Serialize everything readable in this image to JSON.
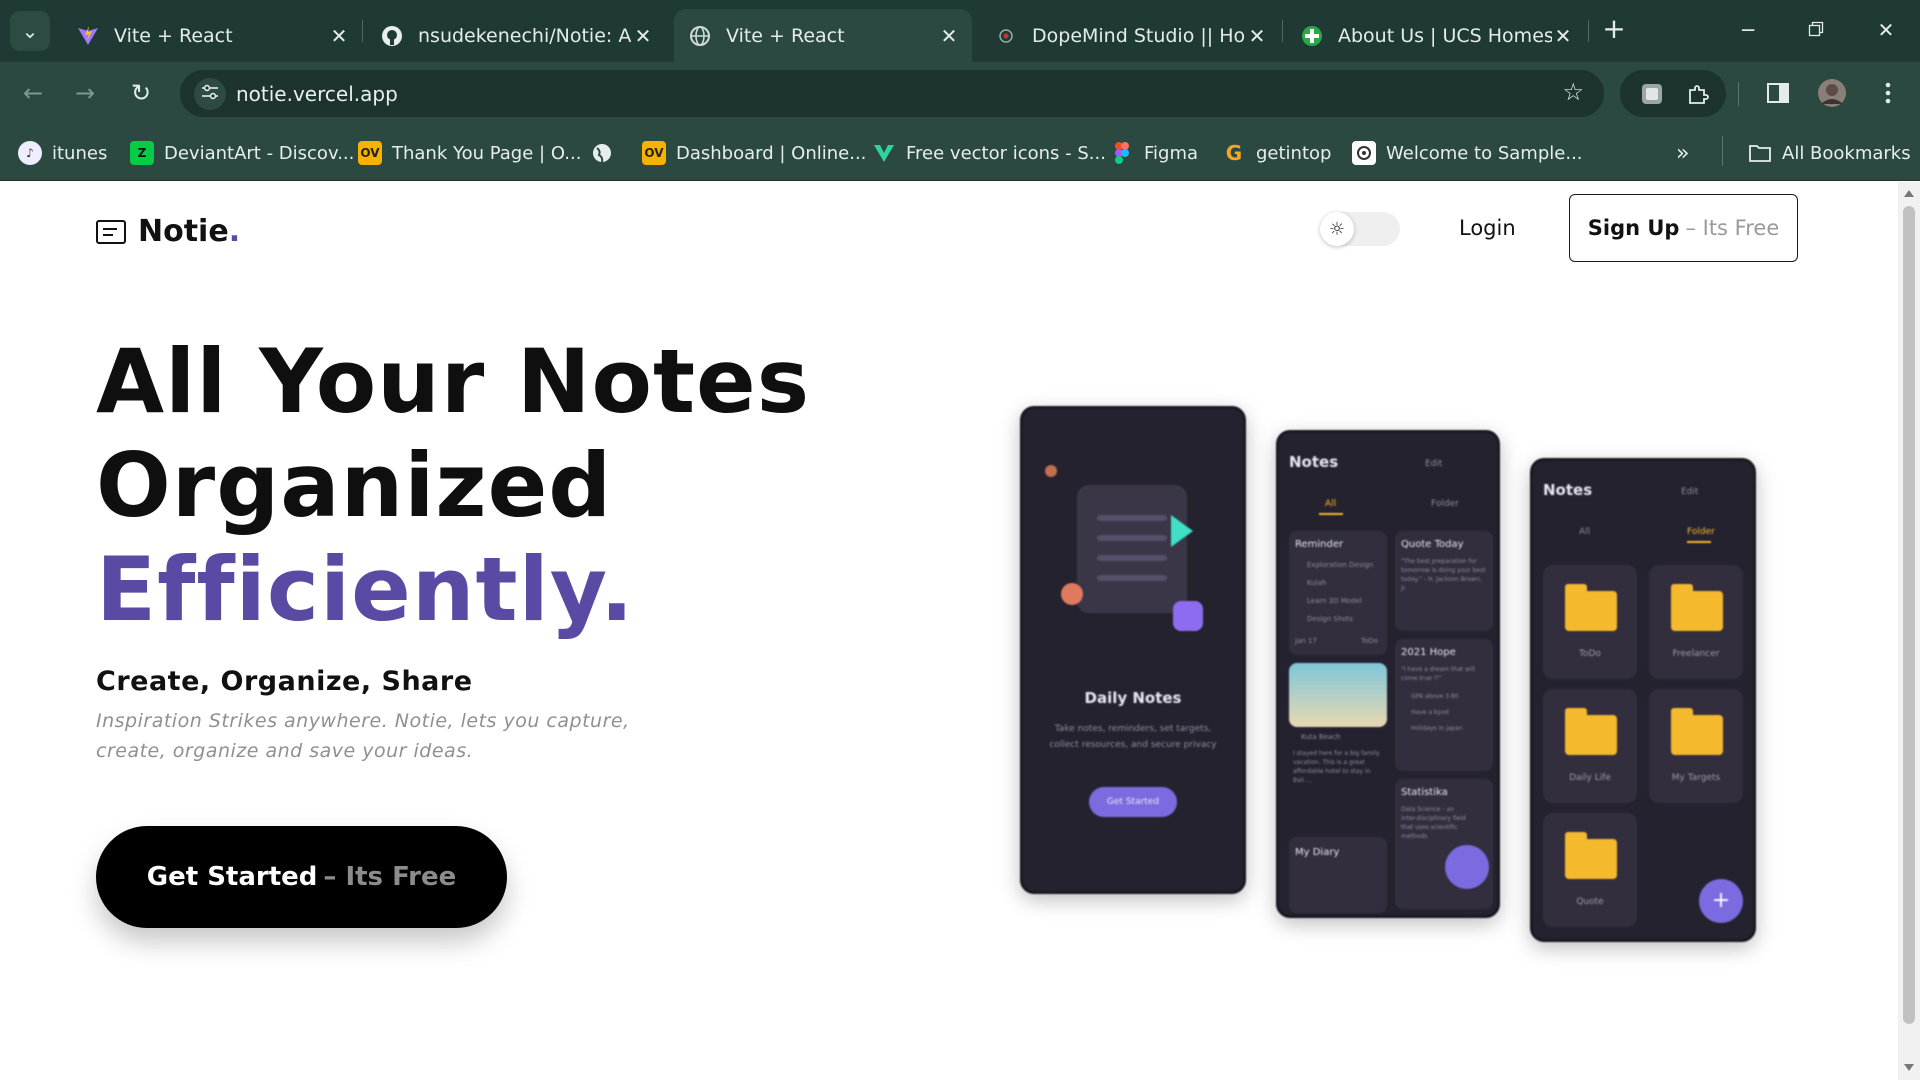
{
  "browser": {
    "tabs": [
      {
        "title": "Vite + React",
        "icon": "vite-icon",
        "active": false
      },
      {
        "title": "nsudekenechi/Notie: An",
        "icon": "github-icon",
        "active": false
      },
      {
        "title": "Vite + React",
        "icon": "globe-icon",
        "active": true
      },
      {
        "title": "DopeMind Studio || Hom",
        "icon": "dopemind-icon",
        "active": false
      },
      {
        "title": "About Us | UCS Homes",
        "icon": "ucs-homes-icon",
        "active": false
      }
    ],
    "url": "notie.vercel.app",
    "bookmarks": [
      {
        "label": "itunes",
        "icon": "itunes-icon"
      },
      {
        "label": "DeviantArt - Discov...",
        "icon": "deviantart-icon"
      },
      {
        "label": "Thank You Page | O...",
        "icon": "ov-icon"
      },
      {
        "label": "",
        "icon": "globe-icon"
      },
      {
        "label": "Dashboard | Online...",
        "icon": "ov-icon"
      },
      {
        "label": "Free vector icons - S...",
        "icon": "vector-icon"
      },
      {
        "label": "Figma",
        "icon": "figma-icon"
      },
      {
        "label": "getintop",
        "icon": "getintop-icon"
      },
      {
        "label": "Welcome to Sample...",
        "icon": "sample-icon"
      }
    ],
    "all_bookmarks": "All Bookmarks",
    "colors": {
      "frame": "#1f3a34",
      "toolbar": "#2b4841"
    }
  },
  "site": {
    "logo": {
      "name": "Notie",
      "dot": "."
    },
    "nav": {
      "login": "Login",
      "signup_strong": "Sign Up",
      "signup_soft": "– Its Free"
    },
    "hero": {
      "line1": "All Your Notes",
      "line2": "Organized",
      "line3": "Efficiently.",
      "subheading": "Create, Organize, Share",
      "description": "Inspiration Strikes anywhere. Notie, lets you capture, create, organize and save your ideas.",
      "cta_strong": "Get Started",
      "cta_soft": "– Its Free"
    },
    "colors": {
      "accent": "#5b4aa4",
      "folder": "#f5b92e",
      "phone_bg": "#25222f"
    }
  },
  "mockups": {
    "phone1": {
      "title": "Daily Notes",
      "text": "Take notes, reminders, set targets, collect resources, and secure privacy",
      "button": "Get Started"
    },
    "phone2": {
      "title": "Notes",
      "edit": "Edit",
      "tab_all": "All",
      "tab_folder": "Folder",
      "reminder": "Reminder",
      "reminder_items": [
        "Exploration Design",
        "Kulah",
        "Learn 3D Model",
        "Design Shots"
      ],
      "reminder_date": "Jan 17",
      "reminder_tag": "ToDo",
      "quote_title": "Quote Today",
      "quote_text": "\"The best preparation for tomorrow is doing your best today.\" - H. Jackson Brown, Jr.",
      "hope_title": "2021 Hope",
      "hope_sub": "\"I have a dream that will come true !!\"",
      "hope_items": [
        "GPA above 3.80",
        "Have a kpod",
        "Holidays in japan"
      ],
      "beach": "Kuta Beach",
      "beach_text": "I stayed here for a big family vacation. This is a great affordable hotel to stay in Bali ...",
      "statistika": "Statistika",
      "statistika_text": "Data Science - an inter-disciplinary field that uses scientific methods",
      "diary": "My Diary"
    },
    "phone3": {
      "title": "Notes",
      "edit": "Edit",
      "tab_all": "All",
      "tab_folder": "Folder",
      "folders": [
        "ToDo",
        "Freelancer",
        "Daily Life",
        "My Targets",
        "Quote"
      ]
    }
  }
}
